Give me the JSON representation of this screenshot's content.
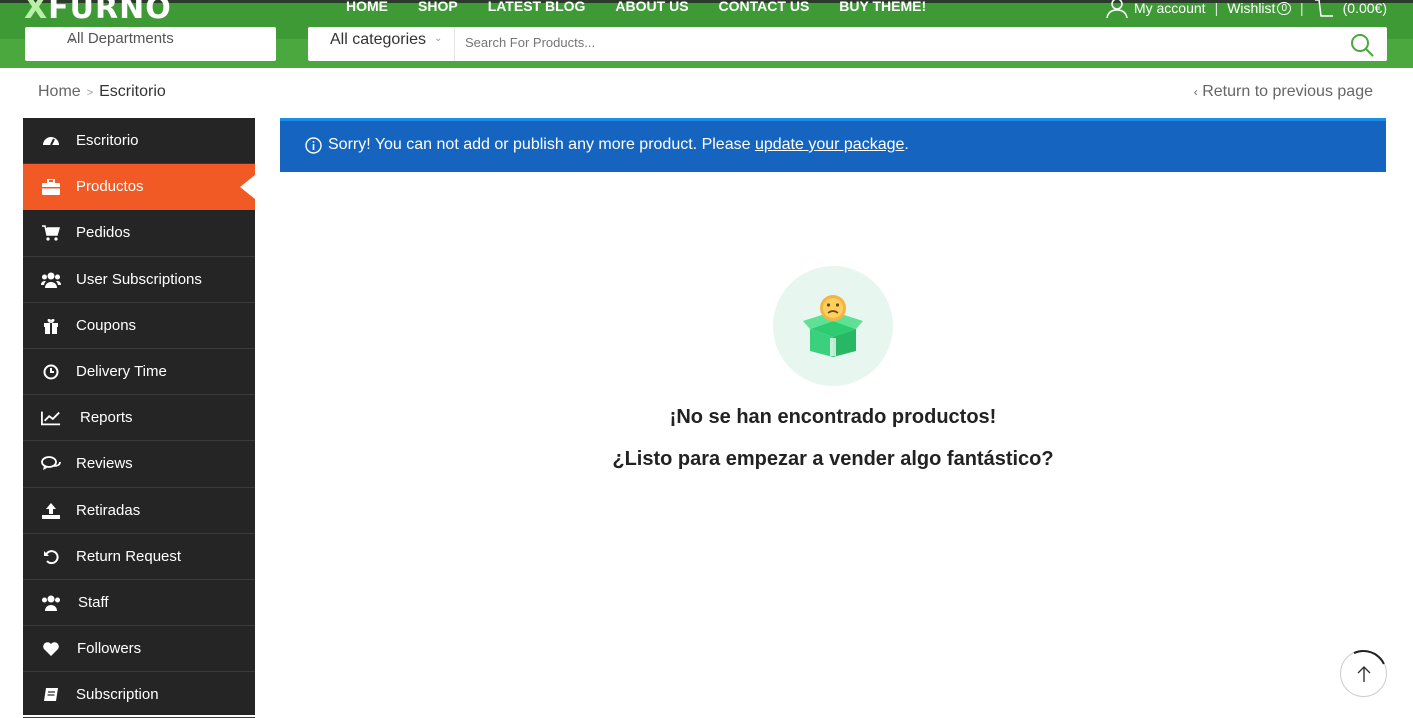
{
  "header": {
    "logo_prefix": "X",
    "logo_rest": "FURNO",
    "nav": [
      "HOME",
      "SHOP",
      "LATEST BLOG",
      "ABOUT US",
      "CONTACT US",
      "BUY THEME!"
    ],
    "account": "My account",
    "wishlist": "Wishlist",
    "wishlist_count": "0",
    "cart_total": "(0.00€)",
    "departments": "All Departments",
    "category": "All categories",
    "search_placeholder": "Search For Products..."
  },
  "breadcrumb": {
    "home": "Home",
    "current": "Escritorio",
    "back": "Return to previous page"
  },
  "sidebar": {
    "items": [
      {
        "label": "Escritorio",
        "icon": "dashboard-icon"
      },
      {
        "label": "Productos",
        "icon": "briefcase-icon"
      },
      {
        "label": "Pedidos",
        "icon": "cart-icon"
      },
      {
        "label": "User Subscriptions",
        "icon": "users-icon"
      },
      {
        "label": "Coupons",
        "icon": "gift-icon"
      },
      {
        "label": "Delivery Time",
        "icon": "clock-icon"
      },
      {
        "label": "Reports",
        "icon": "chart-line-icon"
      },
      {
        "label": "Reviews",
        "icon": "comments-icon"
      },
      {
        "label": "Retiradas",
        "icon": "upload-icon"
      },
      {
        "label": "Return Request",
        "icon": "undo-icon"
      },
      {
        "label": "Staff",
        "icon": "users-icon"
      },
      {
        "label": "Followers",
        "icon": "heart-icon"
      },
      {
        "label": "Subscription",
        "icon": "book-icon"
      }
    ],
    "active_index": 1
  },
  "notice": {
    "text": "Sorry! You can not add or publish any more product. Please ",
    "link": "update your package",
    "end": "."
  },
  "empty": {
    "title": "¡No se han encontrado productos!",
    "subtitle": "¿Listo para empezar a vender algo fantástico?"
  },
  "colors": {
    "green": "#4aa83f",
    "sidebar": "#252525",
    "active": "#f15a24",
    "notice": "#1565c0"
  }
}
